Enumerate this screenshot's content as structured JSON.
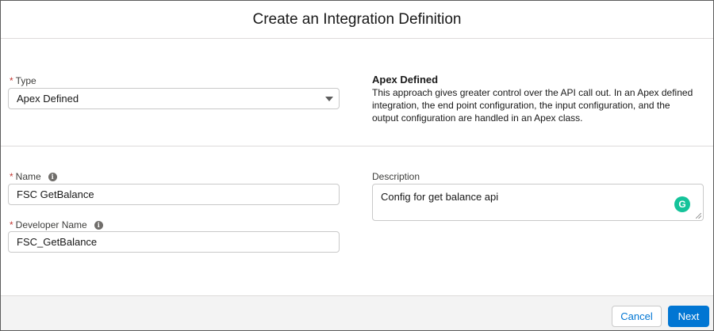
{
  "modal": {
    "title": "Create an Integration Definition"
  },
  "type_field": {
    "required_marker": "*",
    "label": "Type",
    "value": "Apex Defined"
  },
  "info_panel": {
    "title": "Apex Defined",
    "text": "This approach gives greater control over the API call out. In an Apex defined integration, the end point configuration, the input configuration, and the output configuration are handled in an Apex class."
  },
  "name_field": {
    "required_marker": "*",
    "label": "Name",
    "value": "FSC GetBalance"
  },
  "developer_name_field": {
    "required_marker": "*",
    "label": "Developer Name",
    "value": "FSC_GetBalance"
  },
  "description_field": {
    "label": "Description",
    "value": "Config for get balance api"
  },
  "icons": {
    "info": "i",
    "grammarly": "G"
  },
  "footer": {
    "cancel_label": "Cancel",
    "next_label": "Next"
  },
  "colors": {
    "brand": "#0176d3",
    "required": "#c23934",
    "grammarly": "#15c39a"
  }
}
